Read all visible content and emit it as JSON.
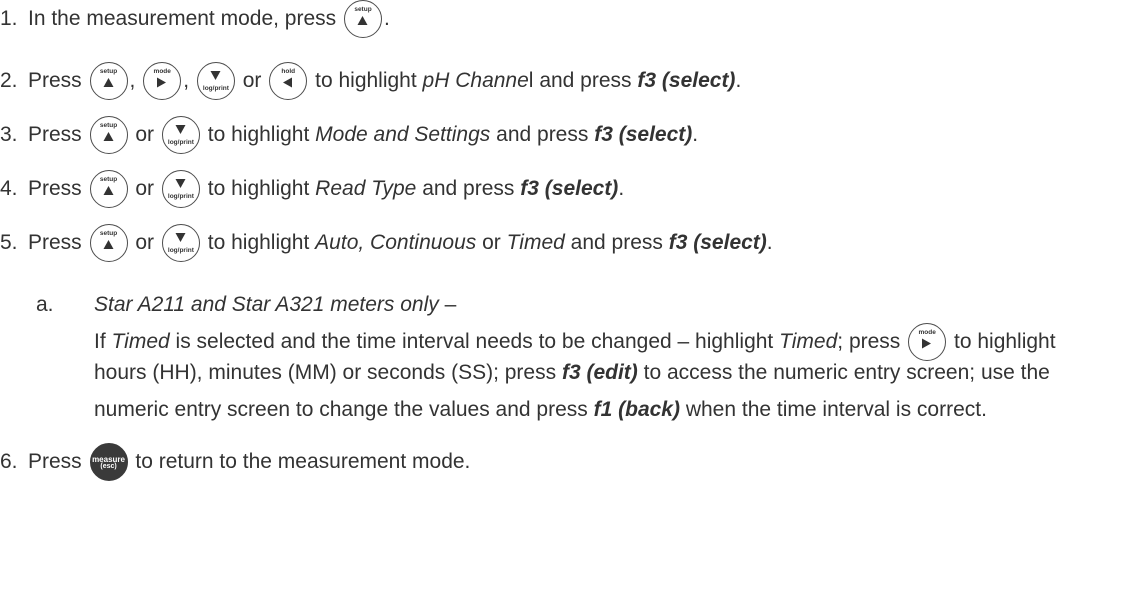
{
  "keys": {
    "setup": "setup",
    "mode": "mode",
    "hold": "hold",
    "log_print": "log/print",
    "measure_line1": "measure",
    "measure_line2": "(esc)"
  },
  "steps": [
    {
      "num": "1.",
      "before": "In the measurement mode, press",
      "after": "."
    },
    {
      "num": "2.",
      "before": "Press",
      "sep1": ",",
      "sep2": ",",
      "or": "or",
      "mid": "to highlight",
      "target": "pH Channe",
      "target_tail": "l",
      "and_press": "and press",
      "action": "f3 (select)",
      "end": "."
    },
    {
      "num": "3.",
      "before": "Press",
      "or": "or",
      "mid": "to highlight",
      "target": "Mode and Settings",
      "and_press": "and press",
      "action": "f3 (select)",
      "end": "."
    },
    {
      "num": "4.",
      "before": "Press",
      "or": "or",
      "mid": "to highlight",
      "target": "Read Type",
      "and_press": "and press",
      "action": "f3 (select)",
      "end": "."
    },
    {
      "num": "5.",
      "before": "Press",
      "or": "or",
      "mid": "to highlight",
      "target1": "Auto, Continuous",
      "or2": "or",
      "target2": "Timed",
      "and_press": "and press",
      "action": "f3 (select)",
      "end": "."
    },
    {
      "num": "6.",
      "before": "Press",
      "after": "to return to the measurement mode."
    }
  ],
  "substep": {
    "letter": "a.",
    "title": "Star A211 and Star A321 meters only",
    "dash": "–",
    "l1_a": "If",
    "l1_timed": "Timed",
    "l1_b": "is selected and the time interval needs to be changed – highlight",
    "l1_timed2": "Timed",
    "l1_c": "; press",
    "l1_d": "to highlight",
    "l2_a": "hours (HH), minutes (MM) or seconds (SS); press",
    "l2_edit": "f3 (edit)",
    "l2_b": "to access the numeric entry screen; use the",
    "l3_a": "numeric entry screen to change the values and press",
    "l3_back": "f1 (back)",
    "l3_b": "when the time interval is correct."
  }
}
